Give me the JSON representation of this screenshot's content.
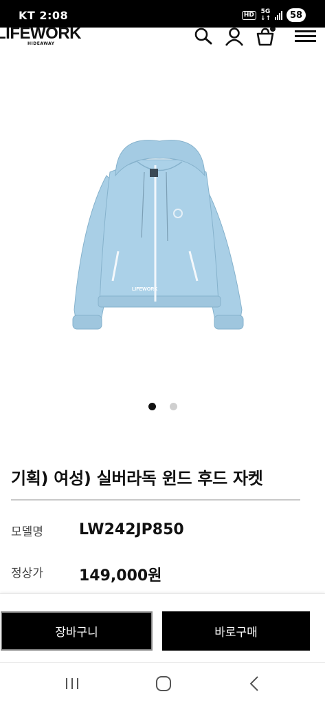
{
  "status_bar": {
    "time": "KT 2:08",
    "hd": "HD",
    "network_top": "5G",
    "network_bottom": "↓↑",
    "battery": "58"
  },
  "header": {
    "logo": "LIFEWORK",
    "logo_sub": "HIDEAWAY",
    "icons": [
      "search-icon",
      "user-icon",
      "shopping-bag-icon",
      "hamburger-menu-icon"
    ]
  },
  "product": {
    "image_print": "LIFEWORK",
    "image_count": 2,
    "active_image": 1,
    "title": "기획) 여성) 실버라독 윈드 후드 자켓",
    "model_label": "모델명",
    "model_value": "LW242JP850",
    "price_label": "정상가",
    "price_value": "149,000원",
    "jacket_color": "#a9cfe6"
  },
  "actions": {
    "cart_label": "장바구니",
    "buy_label": "바로구매"
  },
  "nav": {
    "icons": [
      "recent-apps-icon",
      "home-icon",
      "back-icon"
    ]
  }
}
